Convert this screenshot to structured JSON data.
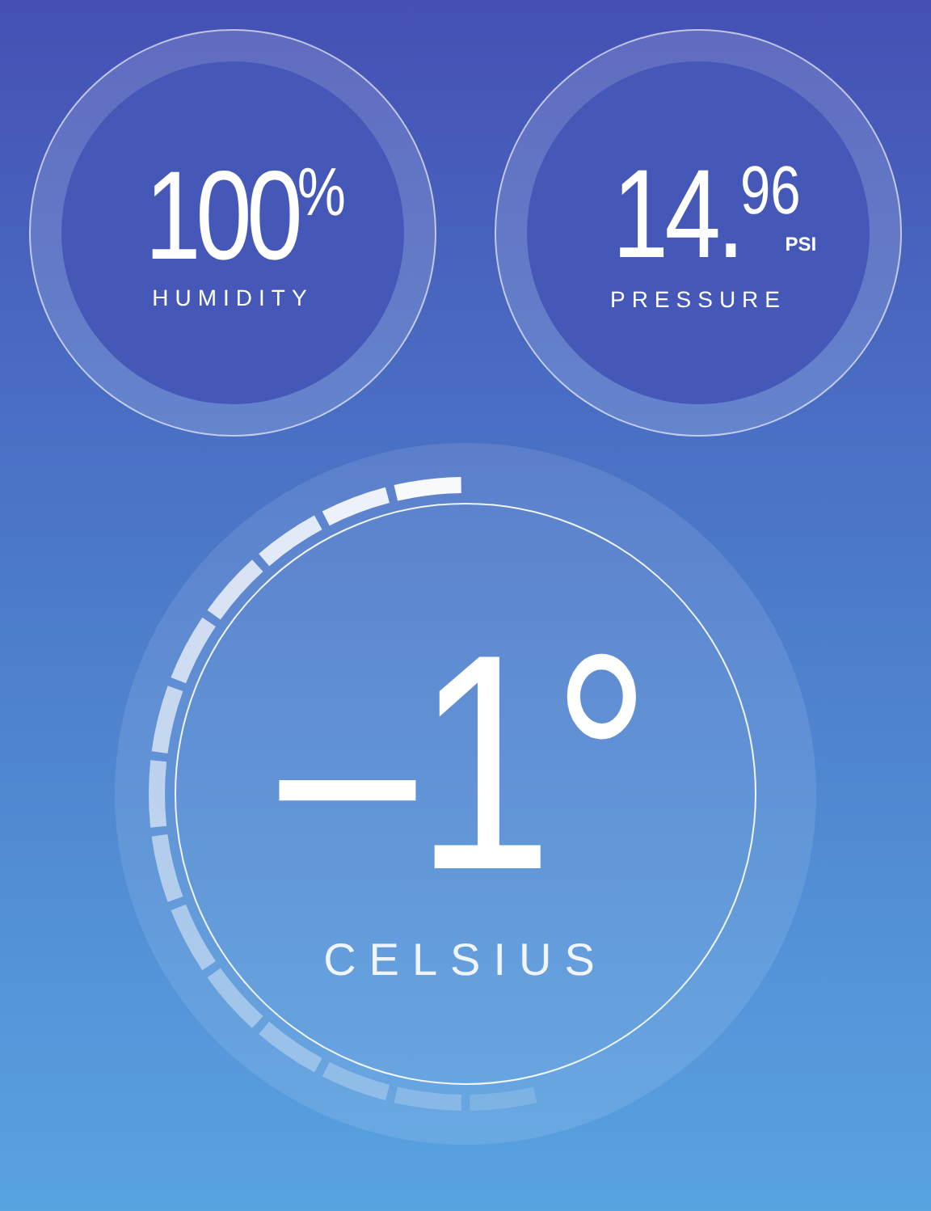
{
  "humidity": {
    "value": "100",
    "unit": "%",
    "label": "HUMIDITY"
  },
  "pressure": {
    "value": "14.",
    "decimals": "96",
    "unit": "PSI",
    "label": "PRESSURE"
  },
  "temperature": {
    "value": "–1°",
    "label": "CELSIUS",
    "level": 0.55
  }
}
